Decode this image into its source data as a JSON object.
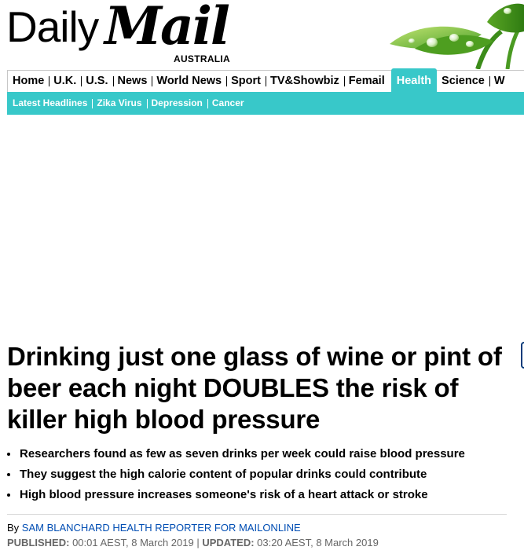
{
  "masthead": {
    "logo_daily": "Daily",
    "logo_mail": "Mail",
    "edition": "AUSTRALIA"
  },
  "nav_primary": [
    {
      "label": "Home"
    },
    {
      "label": "U.K."
    },
    {
      "label": "U.S."
    },
    {
      "label": "News"
    },
    {
      "label": "World News"
    },
    {
      "label": "Sport"
    },
    {
      "label": "TV&Showbiz"
    },
    {
      "label": "Femail"
    },
    {
      "label": "Health",
      "active": true
    },
    {
      "label": "Science"
    },
    {
      "label": "W"
    }
  ],
  "nav_secondary": [
    {
      "label": "Latest Headlines"
    },
    {
      "label": "Zika Virus"
    },
    {
      "label": "Depression"
    },
    {
      "label": "Cancer"
    }
  ],
  "article": {
    "headline": "Drinking just one glass of wine or pint of beer each night DOUBLES the risk of killer high blood pressure",
    "bullets": [
      "Researchers found as few as seven drinks per week could raise blood pressure",
      "They suggest the high calorie content of popular drinks could contribute",
      "High blood pressure increases someone's risk of a heart attack or stroke"
    ],
    "byline_prefix": "By ",
    "author": "SAM BLANCHARD HEALTH REPORTER FOR MAILONLINE",
    "published_label": "PUBLISHED:",
    "published_value": " 00:01 AEST, 8 March 2019",
    "separator": " | ",
    "updated_label": "UPDATED:",
    "updated_value": " 03:20 AEST, 8 March 2019"
  },
  "colors": {
    "accent_teal": "#38c8c9",
    "author_blue": "#004db3",
    "date_gray": "#666666"
  },
  "icons": {
    "masthead_art": "green-leaves-with-water-drops"
  }
}
